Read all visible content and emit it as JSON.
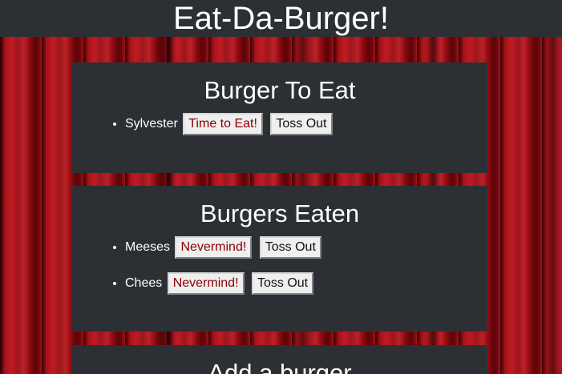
{
  "header": {
    "title": "Eat-Da-Burger!"
  },
  "to_eat": {
    "title": "Burger To Eat",
    "items": [
      {
        "name": "Sylvester",
        "primary_action": "Time to Eat!",
        "secondary_action": "Toss Out"
      }
    ]
  },
  "eaten": {
    "title": "Burgers Eaten",
    "items": [
      {
        "name": "Meeses",
        "primary_action": "Nevermind!",
        "secondary_action": "Toss Out"
      },
      {
        "name": "Chees",
        "primary_action": "Nevermind!",
        "secondary_action": "Toss Out"
      }
    ]
  },
  "add": {
    "title": "Add a burger"
  },
  "colors": {
    "panel": "#2c3034",
    "background": "#8e0a10",
    "action_text": "#8b0000"
  }
}
